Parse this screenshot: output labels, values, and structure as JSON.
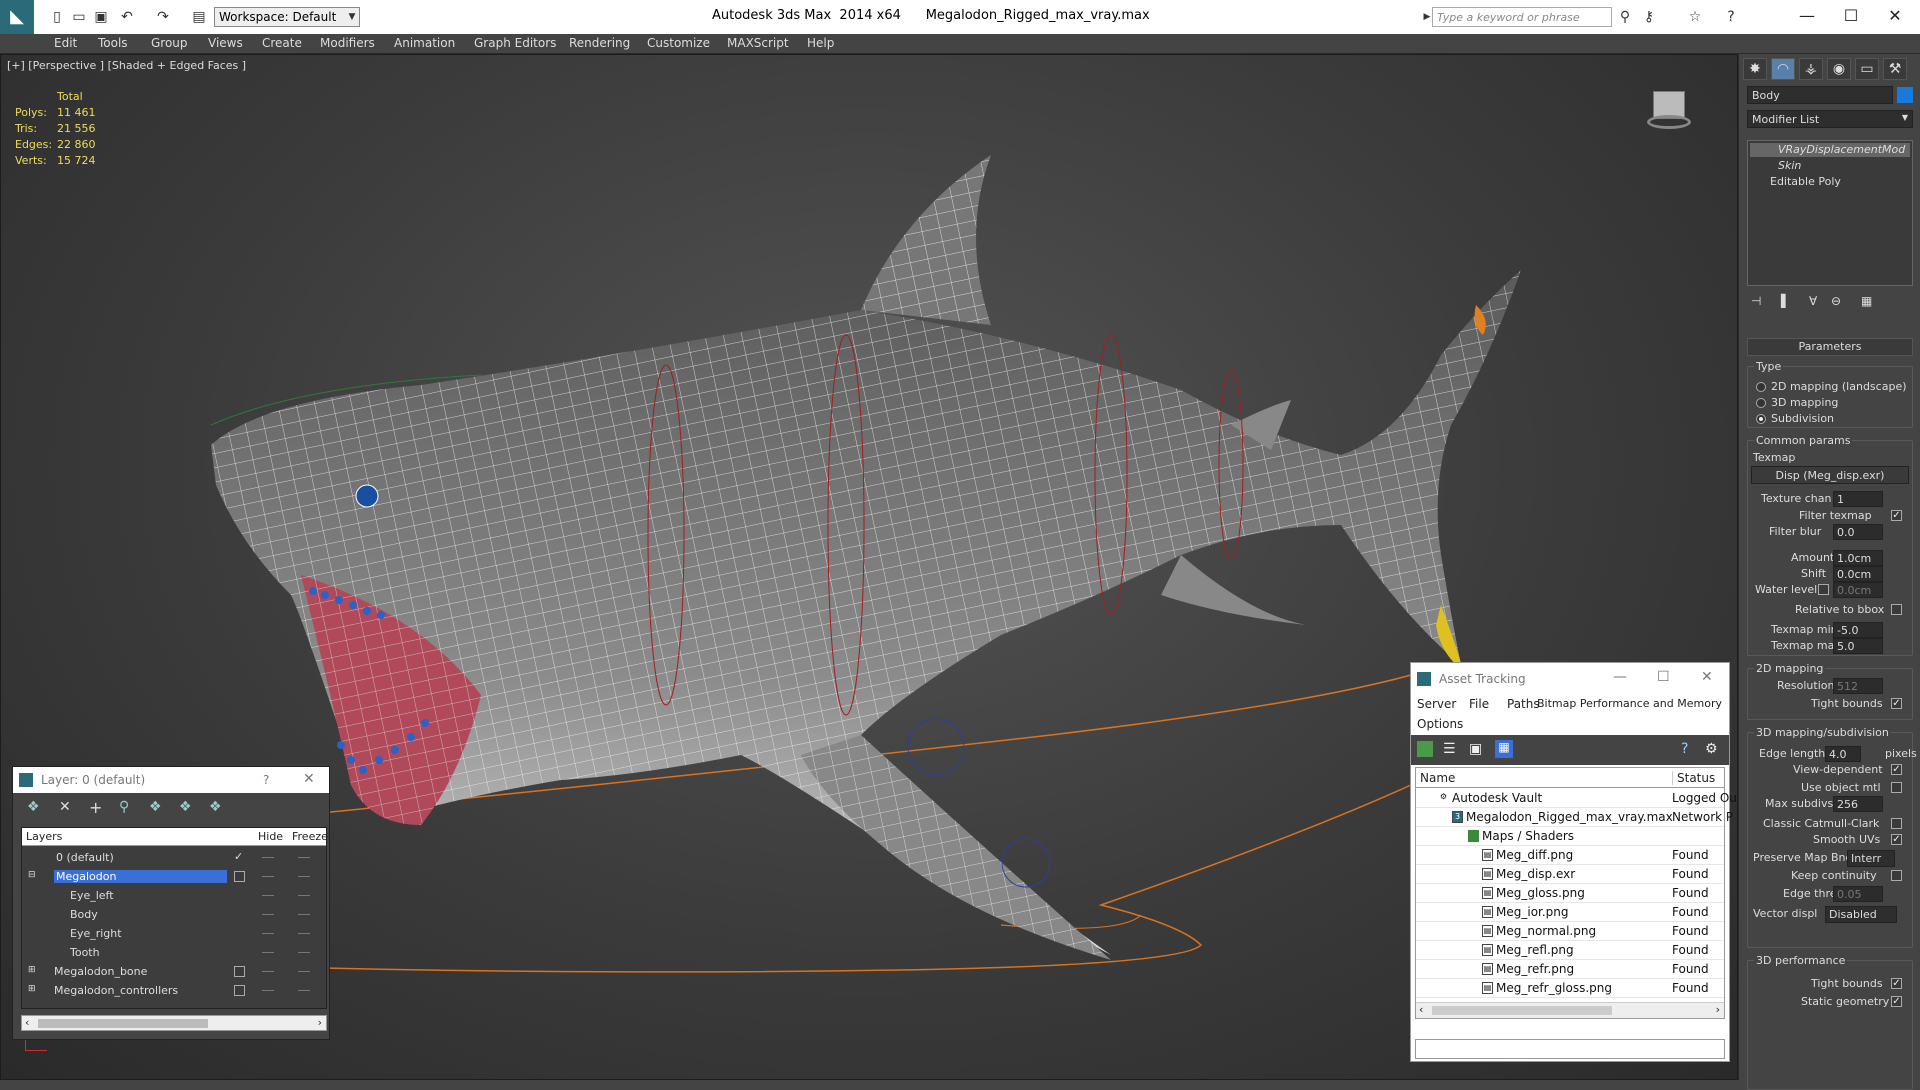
{
  "titlebar": {
    "app_title": "Autodesk 3ds Max  2014 x64",
    "file_name": "Megalodon_Rigged_max_vray.max",
    "workspace": "Workspace: Default",
    "search_placeholder": "Type a keyword or phrase"
  },
  "menu": [
    "Edit",
    "Tools",
    "Group",
    "Views",
    "Create",
    "Modifiers",
    "Animation",
    "Graph Editors",
    "Rendering",
    "Customize",
    "MAXScript",
    "Help"
  ],
  "viewport": {
    "label": "[+] [Perspective ] [Shaded + Edged Faces ]",
    "stats": {
      "header": "Total",
      "rows": [
        {
          "label": "Polys:",
          "value": "11 461"
        },
        {
          "label": "Tris:",
          "value": "21 556"
        },
        {
          "label": "Edges:",
          "value": "22 860"
        },
        {
          "label": "Verts:",
          "value": "15 724"
        }
      ]
    }
  },
  "command_panel": {
    "object_name": "Body",
    "modifier_list": "Modifier List",
    "stack": [
      "VRayDisplacementMod",
      "Skin",
      "Editable Poly"
    ],
    "parameters_header": "Parameters",
    "type": {
      "title": "Type",
      "options": [
        "2D mapping (landscape)",
        "3D mapping",
        "Subdivision"
      ],
      "selected": "Subdivision"
    },
    "common": {
      "title": "Common params",
      "texmap_label": "Texmap",
      "texmap_value": "Disp (Meg_disp.exr)",
      "texture_chan_label": "Texture chan",
      "texture_chan": "1",
      "filter_texmap_label": "Filter texmap",
      "filter_blur_label": "Filter blur",
      "filter_blur": "0.0",
      "amount_label": "Amount",
      "amount": "1.0cm",
      "shift_label": "Shift",
      "shift": "0.0cm",
      "water_level_label": "Water level",
      "water_level": "0.0cm",
      "relative_bbox_label": "Relative to bbox",
      "texmap_min_label": "Texmap min",
      "texmap_min": "-5.0",
      "texmap_max_label": "Texmap max",
      "texmap_max": "5.0"
    },
    "mapping2d": {
      "title": "2D mapping",
      "resolution_label": "Resolution",
      "resolution": "512",
      "tight_bounds_label": "Tight bounds"
    },
    "mapping3d": {
      "title": "3D mapping/subdivision",
      "edge_length_label": "Edge length",
      "edge_length": "4.0",
      "pixels_label": "pixels",
      "view_dependent_label": "View-dependent",
      "use_object_mtl_label": "Use object mtl",
      "max_subdivs_label": "Max subdivs",
      "max_subdivs": "256",
      "classic_label": "Classic Catmull-Clark",
      "smooth_uvs_label": "Smooth UVs",
      "preserve_label": "Preserve Map Bnd",
      "preserve_value": "Interr",
      "keep_continuity_label": "Keep continuity",
      "edge_thresh_label": "Edge thresh",
      "edge_thresh": "0.05",
      "vector_displ_label": "Vector displ",
      "vector_displ": "Disabled"
    },
    "perf": {
      "title": "3D performance",
      "tight_bounds_label": "Tight bounds",
      "static_geometry_label": "Static geometry"
    }
  },
  "layer_window": {
    "title": "Layer: 0 (default)",
    "help": "?",
    "columns": [
      "Layers",
      "Hide",
      "Freeze"
    ],
    "rows": [
      {
        "name": "0 (default)",
        "indent": 0
      },
      {
        "name": "Megalodon",
        "indent": 0
      },
      {
        "name": "Eye_left",
        "indent": 1
      },
      {
        "name": "Body",
        "indent": 1
      },
      {
        "name": "Eye_right",
        "indent": 1
      },
      {
        "name": "Tooth",
        "indent": 1
      },
      {
        "name": "Megalodon_bone",
        "indent": 0
      },
      {
        "name": "Megalodon_controllers",
        "indent": 0
      }
    ]
  },
  "asset_tracking": {
    "title": "Asset Tracking",
    "menu": [
      "Server",
      "File",
      "Paths",
      "Bitmap Performance and Memory",
      "Options"
    ],
    "columns": [
      "Name",
      "Status"
    ],
    "rows": [
      {
        "name": "Autodesk Vault",
        "status": "Logged Ou",
        "indent": 0
      },
      {
        "name": "Megalodon_Rigged_max_vray.max",
        "status": "Network P",
        "indent": 1
      },
      {
        "name": "Maps / Shaders",
        "status": "",
        "indent": 2
      },
      {
        "name": "Meg_diff.png",
        "status": "Found",
        "indent": 3
      },
      {
        "name": "Meg_disp.exr",
        "status": "Found",
        "indent": 3
      },
      {
        "name": "Meg_gloss.png",
        "status": "Found",
        "indent": 3
      },
      {
        "name": "Meg_ior.png",
        "status": "Found",
        "indent": 3
      },
      {
        "name": "Meg_normal.png",
        "status": "Found",
        "indent": 3
      },
      {
        "name": "Meg_refl.png",
        "status": "Found",
        "indent": 3
      },
      {
        "name": "Meg_refr.png",
        "status": "Found",
        "indent": 3
      },
      {
        "name": "Meg_refr_gloss.png",
        "status": "Found",
        "indent": 3
      }
    ]
  },
  "colors": {
    "accent_blue": "#3a6fd8",
    "stats_yellow": "#eedc5a",
    "spline_orange": "#d9731f"
  }
}
